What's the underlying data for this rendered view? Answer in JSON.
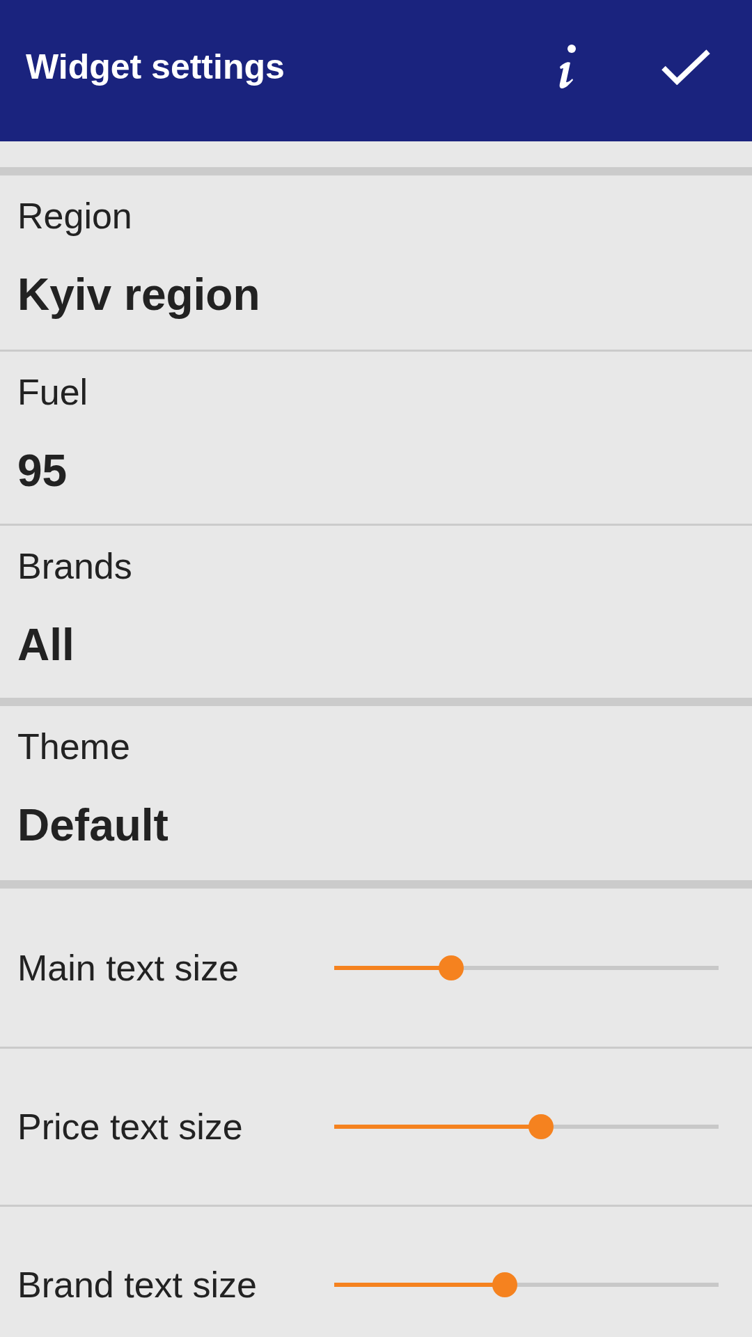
{
  "app_bar": {
    "title": "Widget settings"
  },
  "groups": [
    {
      "items": [
        {
          "kind": "choice",
          "label": "Region",
          "value": "Kyiv region"
        },
        {
          "kind": "choice",
          "label": "Fuel",
          "value": "95"
        },
        {
          "kind": "choice",
          "label": "Brands",
          "value": "All"
        }
      ]
    },
    {
      "items": [
        {
          "kind": "choice",
          "label": "Theme",
          "value": "Default"
        }
      ]
    },
    {
      "items": [
        {
          "kind": "slider",
          "label": "Main text size",
          "level": 0.29
        },
        {
          "kind": "slider",
          "label": "Price text size",
          "level": 0.54
        },
        {
          "kind": "slider",
          "label": "Brand text size",
          "level": 0.44
        }
      ]
    }
  ]
}
